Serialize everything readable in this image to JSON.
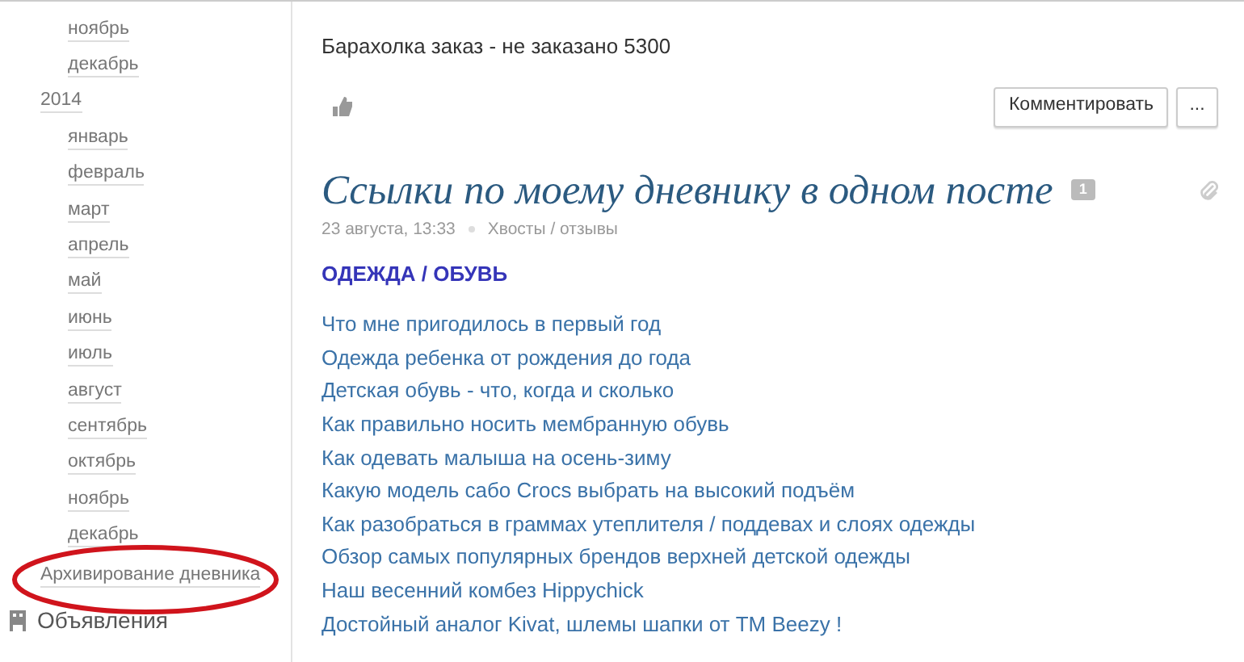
{
  "sidebar": {
    "leading_months": [
      {
        "label": "ноябрь"
      },
      {
        "label": "декабрь"
      }
    ],
    "years": [
      {
        "label": "2014",
        "children": [
          {
            "label": "январь"
          },
          {
            "label": "февраль"
          },
          {
            "label": "март"
          },
          {
            "label": "апрель"
          },
          {
            "label": "май"
          },
          {
            "label": "июнь"
          },
          {
            "label": "июль"
          },
          {
            "label": "август"
          },
          {
            "label": "сентябрь"
          },
          {
            "label": "октябрь"
          },
          {
            "label": "ноябрь"
          },
          {
            "label": "декабрь"
          }
        ]
      }
    ],
    "archive_link": {
      "label": "Архивирование дневника",
      "circled": true
    },
    "ads_link": {
      "label": "Объявления"
    }
  },
  "previous_post": {
    "text": "Барахолка заказ - не заказано 5300",
    "comment_button": "Комментировать",
    "more_button": "..."
  },
  "post": {
    "title": "Ссылки по моему дневнику в одном посте",
    "comment_count": "1",
    "date": "23 августа, 13:33",
    "tags": "Хвосты / отзывы",
    "section_heading": "ОДЕЖДА / ОБУВЬ",
    "links": [
      "Что мне пригодилось в первый год",
      "Одежда ребенка от рождения до года",
      "Детская обувь - что, когда и сколько",
      "Как правильно носить мембранную обувь",
      "Как одевать малыша на осень-зиму",
      "Какую модель сабо Crocs выбрать на высокий подъём",
      "Как разобраться в граммах утеплителя / поддевах и слоях одежды",
      "Обзор самых популярных брендов верхней детской одежды",
      "Наш весенний комбез Hippychick",
      "Достойный аналог Kivat, шлемы шапки от ТМ Beezy !"
    ]
  }
}
